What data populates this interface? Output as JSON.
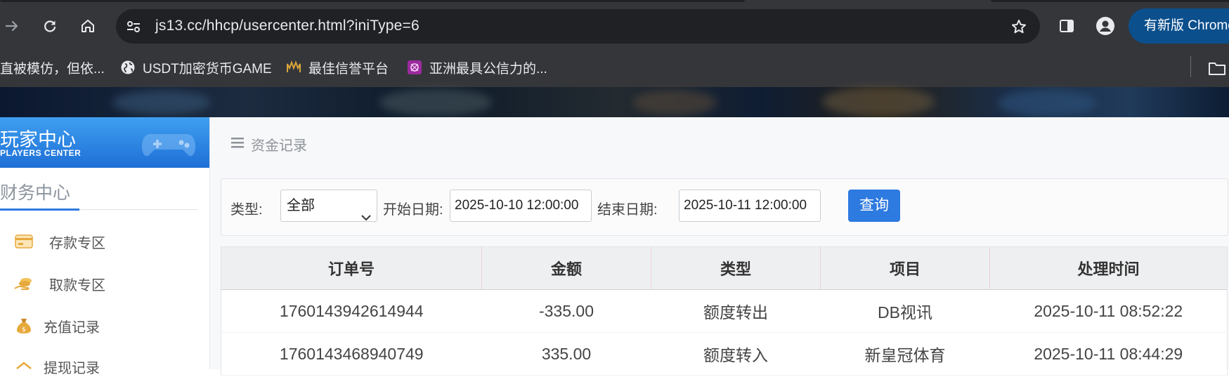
{
  "browser": {
    "url": "js13.cc/hhcp/usercenter.html?iniType=6",
    "update_button": "有新版 Chrome",
    "bookmarks": [
      {
        "label": "直被模仿，但依...",
        "icon": "none"
      },
      {
        "label": "USDT加密货币GAME",
        "icon": "globe-icon"
      },
      {
        "label": "最佳信誉平台",
        "icon": "brand-icon"
      },
      {
        "label": "亚洲最具公信力的...",
        "icon": "brand-icon"
      }
    ]
  },
  "sidebar": {
    "header_title": "玩家中心",
    "header_subtitle": "PLAYERS CENTER",
    "section_title": "财务中心",
    "items": [
      {
        "label": "存款专区",
        "icon": "card-icon"
      },
      {
        "label": "取款专区",
        "icon": "hand-coin-icon"
      },
      {
        "label": "充值记录",
        "icon": "money-bag-icon"
      },
      {
        "label": "提现记录",
        "icon": "withdraw-icon"
      }
    ]
  },
  "main": {
    "breadcrumb": "资金记录",
    "filter": {
      "type_label": "类型:",
      "type_value": "全部",
      "start_label": "开始日期:",
      "start_value": "2025-10-10 12:00:00",
      "end_label": "结束日期:",
      "end_value": "2025-10-11 12:00:00",
      "query_button": "查询"
    },
    "table": {
      "headers": [
        "订单号",
        "金额",
        "类型",
        "项目",
        "处理时间"
      ],
      "rows": [
        [
          "1760143942614944",
          "-335.00",
          "额度转出",
          "DB视讯",
          "2025-10-11 08:52:22"
        ],
        [
          "1760143468940749",
          "335.00",
          "额度转入",
          "新皇冠体育",
          "2025-10-11 08:44:29"
        ]
      ]
    }
  },
  "colors": {
    "chrome_bg": "#35363a",
    "omnibox_bg": "#202124",
    "accent_blue": "#2d7ae0",
    "sidebar_header": "#1e6fd6"
  }
}
